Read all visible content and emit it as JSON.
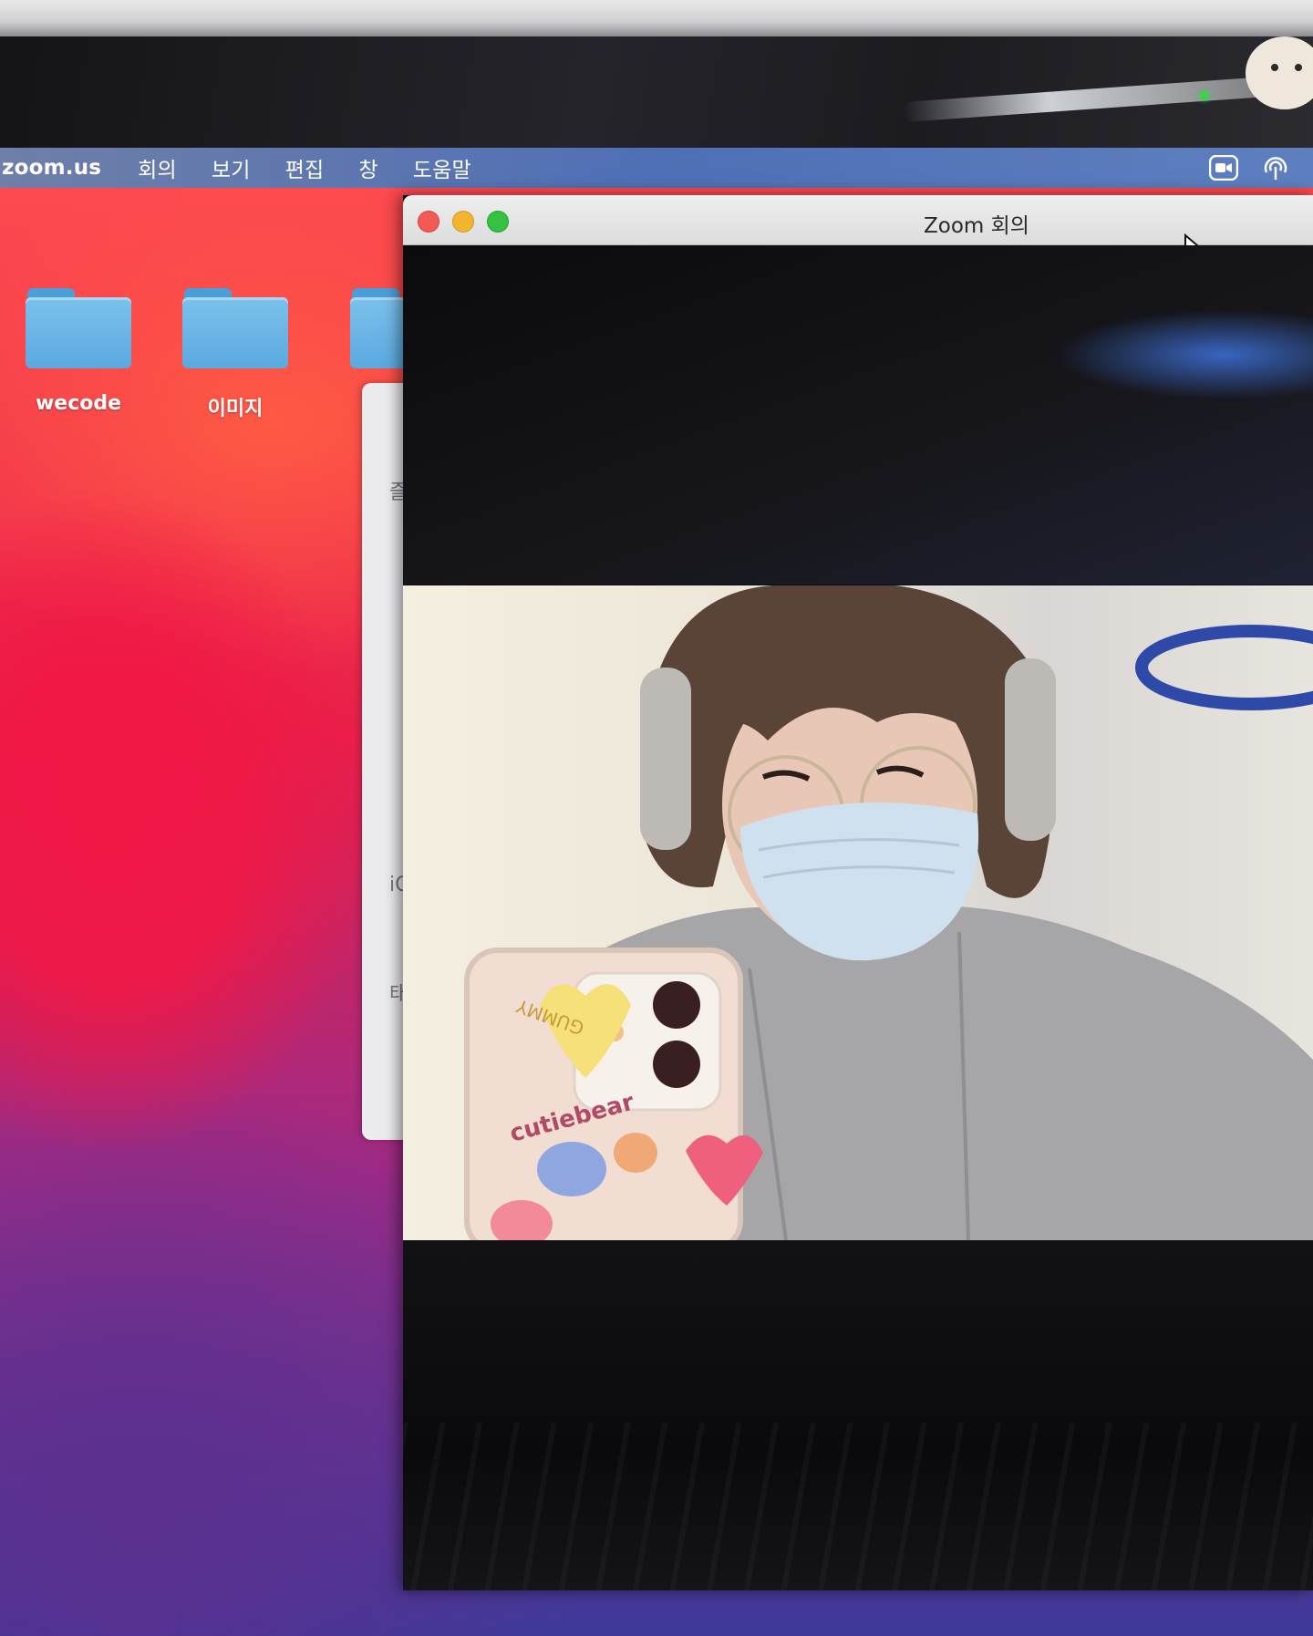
{
  "menubar": {
    "app_name": "zoom.us",
    "items": [
      "회의",
      "보기",
      "편집",
      "창",
      "도움말"
    ],
    "status_icons": [
      "zoom-video-icon",
      "airdrop-icon"
    ]
  },
  "desktop": {
    "folders": [
      {
        "label": "wecode"
      },
      {
        "label": "이미지"
      },
      {
        "label": ""
      }
    ]
  },
  "finder_partial": {
    "visible_chars": [
      "즐",
      "iC",
      "태"
    ]
  },
  "zoom_window": {
    "title": "Zoom 회의"
  },
  "video": {
    "phone_case_stickers": [
      "GUMMY",
      "cutiebear"
    ]
  },
  "colors": {
    "menubar": "#5270b4",
    "zoom_close": "#f35a53",
    "zoom_minimize": "#f2b530",
    "zoom_maximize": "#36c142",
    "folder_blue": "#6bb5e6",
    "camera_led": "#3bd34a"
  }
}
